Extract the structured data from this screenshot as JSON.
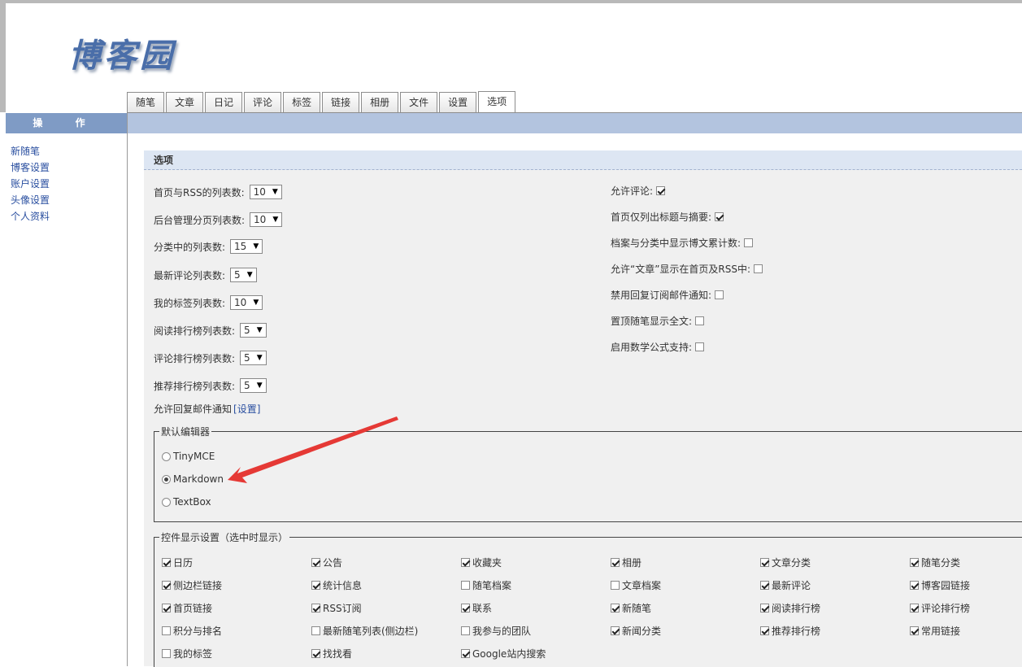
{
  "logo": "博客园",
  "tabs": [
    "随笔",
    "文章",
    "日记",
    "评论",
    "标签",
    "链接",
    "相册",
    "文件",
    "设置",
    "选项"
  ],
  "active_tab": "选项",
  "sidebar": {
    "title": "操 作",
    "items": [
      "新随笔",
      "博客设置",
      "账户设置",
      "头像设置",
      "个人资料"
    ]
  },
  "panel_title": "选项",
  "list_settings": [
    {
      "label": "首页与RSS的列表数:",
      "value": "10"
    },
    {
      "label": "后台管理分页列表数:",
      "value": "10"
    },
    {
      "label": "分类中的列表数:",
      "value": "15"
    },
    {
      "label": "最新评论列表数:",
      "value": "5"
    },
    {
      "label": "我的标签列表数:",
      "value": "10"
    },
    {
      "label": "阅读排行榜列表数:",
      "value": "5"
    },
    {
      "label": "评论排行榜列表数:",
      "value": "5"
    },
    {
      "label": "推荐排行榜列表数:",
      "value": "5"
    }
  ],
  "reply_mail": {
    "text": "允许回复邮件通知",
    "link": "[设置]"
  },
  "right_options": [
    {
      "label": "允许评论:",
      "checked": true
    },
    {
      "label": "首页仅列出标题与摘要:",
      "checked": true
    },
    {
      "label": "档案与分类中显示博文累计数:",
      "checked": false
    },
    {
      "label": "允许“文章”显示在首页及RSS中:",
      "checked": false
    },
    {
      "label": "禁用回复订阅邮件通知:",
      "checked": false
    },
    {
      "label": "置顶随笔显示全文:",
      "checked": false
    },
    {
      "label": "启用数学公式支持:",
      "checked": false
    }
  ],
  "editor": {
    "legend": "默认编辑器",
    "options": [
      {
        "label": "TinyMCE",
        "checked": false
      },
      {
        "label": "Markdown",
        "checked": true
      },
      {
        "label": "TextBox",
        "checked": false
      }
    ]
  },
  "widgets": {
    "legend": "控件显示设置（选中时显示）",
    "rows": [
      [
        {
          "label": "日历",
          "checked": true
        },
        {
          "label": "公告",
          "checked": true
        },
        {
          "label": "收藏夹",
          "checked": true
        },
        {
          "label": "相册",
          "checked": true
        },
        {
          "label": "文章分类",
          "checked": true
        },
        {
          "label": "随笔分类",
          "checked": true
        }
      ],
      [
        {
          "label": "侧边栏链接",
          "checked": true
        },
        {
          "label": "统计信息",
          "checked": true
        },
        {
          "label": "随笔档案",
          "checked": false
        },
        {
          "label": "文章档案",
          "checked": false
        },
        {
          "label": "最新评论",
          "checked": true
        },
        {
          "label": "博客园链接",
          "checked": true
        }
      ],
      [
        {
          "label": "首页链接",
          "checked": true
        },
        {
          "label": "RSS订阅",
          "checked": true
        },
        {
          "label": "联系",
          "checked": true
        },
        {
          "label": "新随笔",
          "checked": true
        },
        {
          "label": "阅读排行榜",
          "checked": true
        },
        {
          "label": "评论排行榜",
          "checked": true
        }
      ],
      [
        {
          "label": "积分与排名",
          "checked": false
        },
        {
          "label": "最新随笔列表(侧边栏)",
          "checked": false
        },
        {
          "label": "我参与的团队",
          "checked": false
        },
        {
          "label": "新闻分类",
          "checked": true
        },
        {
          "label": "推荐排行榜",
          "checked": true
        },
        {
          "label": "常用链接",
          "checked": true
        }
      ],
      [
        {
          "label": "我的标签",
          "checked": false
        },
        {
          "label": "找找看",
          "checked": true
        },
        {
          "label": "Google站内搜索",
          "checked": true
        }
      ]
    ]
  },
  "colors": {
    "accent": "#7f9bc5",
    "bar": "#b3c4df",
    "link": "#2a4fa0",
    "arrow": "#e53935"
  }
}
